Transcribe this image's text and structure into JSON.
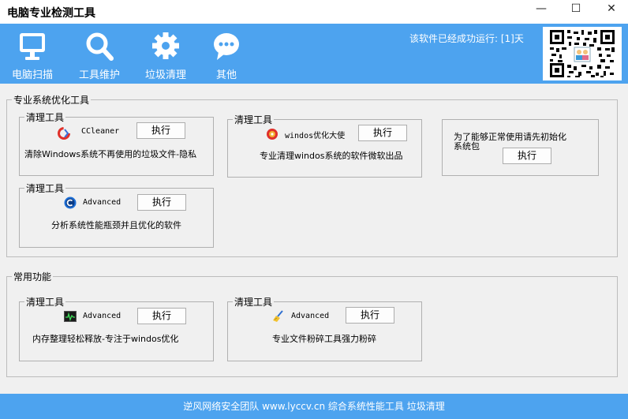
{
  "window": {
    "title": "电脑专业检测工具",
    "minimize_icon": "minimize-icon",
    "maximize_icon": "maximize-icon",
    "close_icon": "close-icon",
    "minimize_glyph": "—",
    "maximize_glyph": "☐",
    "close_glyph": "✕"
  },
  "toolbar": {
    "items": [
      {
        "label": "电脑扫描",
        "icon": "monitor-icon"
      },
      {
        "label": "工具维护",
        "icon": "magnifier-icon"
      },
      {
        "label": "垃圾清理",
        "icon": "gear-icon"
      },
      {
        "label": "其他",
        "icon": "chat-bubble-icon"
      }
    ],
    "runtime_text": "该软件已经成功运行: [1]天",
    "qr_icon": "qr-code-icon"
  },
  "colors": {
    "accent": "#4da3ef",
    "background": "#f0f0f0"
  },
  "groups": [
    {
      "title": "专业系统优化工具",
      "cards": [
        {
          "title": "清理工具",
          "app_name": "CCleaner",
          "icon": "ccleaner-icon",
          "button": "执行",
          "description": "清除Windows系统不再使用的垃圾文件-隐私"
        },
        {
          "title": "清理工具",
          "app_name": "windos优化大使",
          "icon": "optimizer-icon",
          "button": "执行",
          "description": "专业清理windos系统的软件微软出品"
        },
        {
          "title": "",
          "app_name": "",
          "icon": "",
          "button": "执行",
          "description": "为了能够正常使用请先初始化系统包"
        },
        {
          "title": "清理工具",
          "app_name": "Advanced",
          "icon": "advanced-icon",
          "button": "执行",
          "description": "分析系统性能瓶颈并且优化的软件"
        }
      ]
    },
    {
      "title": "常用功能",
      "cards": [
        {
          "title": "清理工具",
          "app_name": "Advanced",
          "icon": "memory-monitor-icon",
          "button": "执行",
          "description": "内存整理轻松释放-专注于windos优化"
        },
        {
          "title": "清理工具",
          "app_name": "Advanced",
          "icon": "shredder-broom-icon",
          "button": "执行",
          "description": "专业文件粉碎工具强力粉碎"
        }
      ]
    }
  ],
  "footer": {
    "text": "逆风网络安全团队 www.lyccv.cn 综合系统性能工具 垃圾清理"
  }
}
